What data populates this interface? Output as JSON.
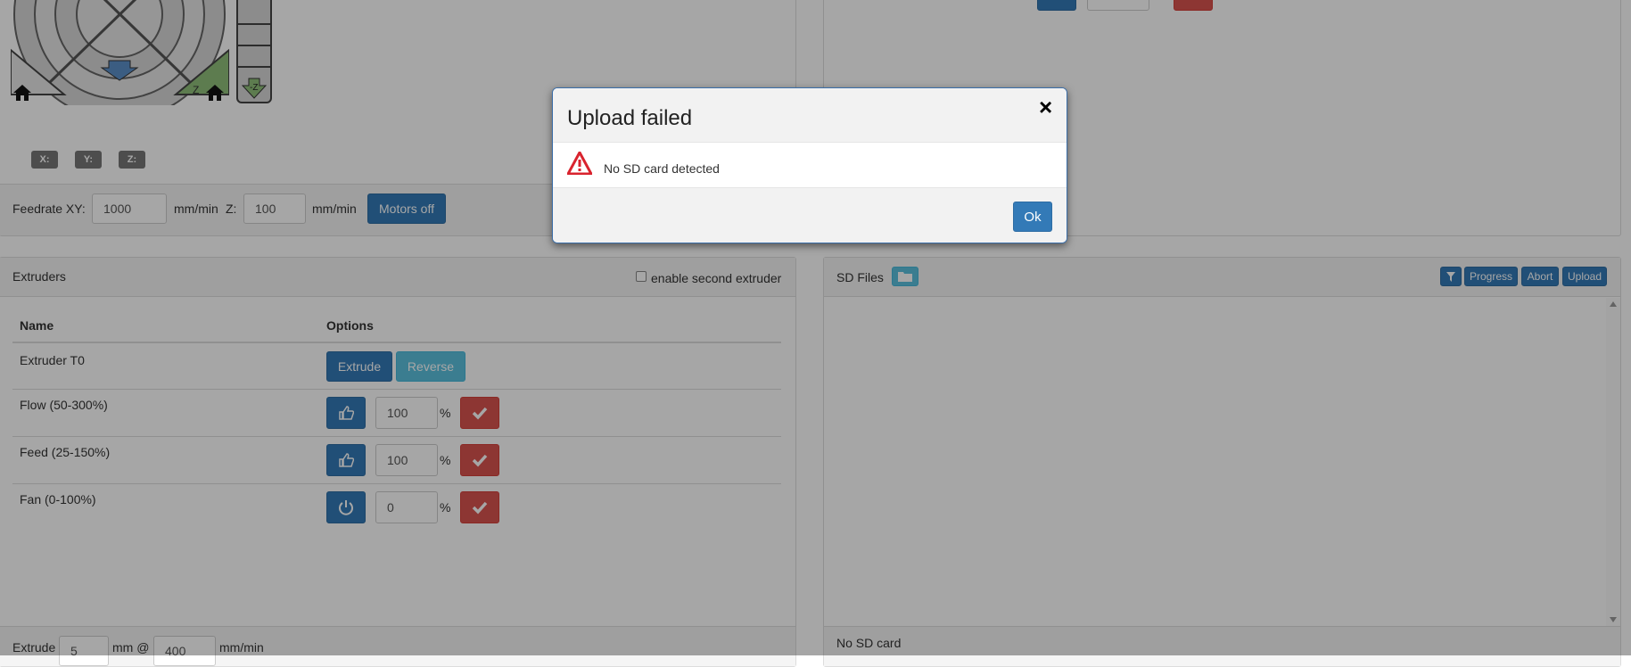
{
  "jog": {
    "axis_badges": [
      "X:",
      "Y:",
      "Z:"
    ],
    "feedrate_label": "Feedrate XY:",
    "feedrate_xy_value": "1000",
    "unit_mm_min": "mm/min",
    "z_label": "Z:",
    "feedrate_z_value": "100",
    "motors_off_label": "Motors off",
    "z_arrow_label": "-Z",
    "z_home_label": "Z"
  },
  "extruders": {
    "title": "Extruders",
    "second_extruder_label": "enable second extruder",
    "columns": [
      "Name",
      "Options"
    ],
    "extruder_name": "Extruder T0",
    "extrude_label": "Extrude",
    "reverse_label": "Reverse",
    "rows": [
      {
        "name": "Flow (50-300%)",
        "value": "100",
        "unit": "%"
      },
      {
        "name": "Feed (25-150%)",
        "value": "100",
        "unit": "%"
      },
      {
        "name": "Fan (0-100%)",
        "value": "0",
        "unit": "%"
      }
    ],
    "footer": {
      "extrude_label": "Extrude",
      "length_value": "5",
      "mm_at_label": "mm @",
      "speed_value": "400",
      "unit_label": "mm/min"
    }
  },
  "sd_files": {
    "title": "SD Files",
    "buttons": [
      "Progress",
      "Abort",
      "Upload"
    ],
    "status": "No SD card"
  },
  "modal": {
    "title": "Upload failed",
    "close_glyph": "×",
    "message": "No SD card detected",
    "ok_label": "Ok"
  },
  "colors": {
    "primary": "#337ab7",
    "info": "#5bc0de",
    "danger": "#d9534f",
    "alert_icon": "#d9232e"
  },
  "icons": [
    "home-icon",
    "arrow-down-icon",
    "thumbs-up-icon",
    "power-icon",
    "check-icon",
    "filter-icon",
    "folder-icon",
    "warning-icon",
    "close-icon",
    "scrollbar-arrow-icon"
  ]
}
